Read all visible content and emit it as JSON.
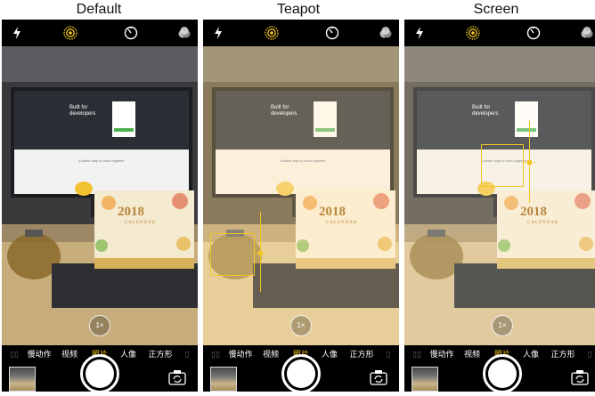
{
  "panels": [
    {
      "title": "Default",
      "zoom_label": "1×",
      "modes": [
        "慢动作",
        "视频",
        "照片",
        "人像",
        "正方形"
      ],
      "active_mode": "照片",
      "icons": [
        "flash-icon",
        "live-photo-icon",
        "timer-icon",
        "filters-icon",
        "flip-camera-icon"
      ]
    },
    {
      "title": "Teapot",
      "zoom_label": "1×",
      "modes": [
        "慢动作",
        "视频",
        "照片",
        "人像",
        "正方形"
      ],
      "active_mode": "照片",
      "focus_target": "teapot",
      "icons": [
        "flash-icon",
        "live-photo-icon",
        "timer-icon",
        "filters-icon",
        "flip-camera-icon"
      ]
    },
    {
      "title": "Screen",
      "zoom_label": "1×",
      "modes": [
        "慢动作",
        "视频",
        "照片",
        "人像",
        "正方形"
      ],
      "active_mode": "照片",
      "focus_target": "screen",
      "icons": [
        "flash-icon",
        "live-photo-icon",
        "timer-icon",
        "filters-icon",
        "flip-camera-icon"
      ]
    }
  ],
  "scene": {
    "monitor_heading": "Built for developers",
    "monitor_tagline": "A better way to work together",
    "calendar_year": "2018",
    "calendar_word": "CALENDAR"
  },
  "colors": {
    "accent_yellow": "#f3c623",
    "ui_black": "#000000",
    "monitor_dark": "#2a2f36",
    "desk": "#c8ad7c",
    "calendar_text": "#b8863b"
  }
}
